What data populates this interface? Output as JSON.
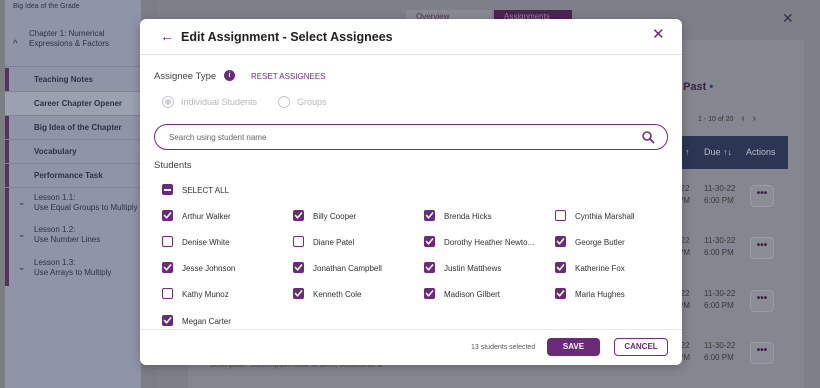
{
  "sidebar": {
    "top_item": "Big Idea of the Grade",
    "chapter": "Chapter 1: Numerical Expressions & Factors",
    "sub_items": [
      "Teaching Notes",
      "Career Chapter Opener",
      "Big Idea of the Chapter",
      "Vocabulary",
      "Performance Task"
    ],
    "lessons": [
      {
        "num": "Lesson 1.1:",
        "title": "Use Equal Groups to Multiply"
      },
      {
        "num": "Lesson 1.2:",
        "title": "Use Number Lines"
      },
      {
        "num": "Lesson 1.3:",
        "title": "Use Arrays to Multiply"
      }
    ]
  },
  "background": {
    "tabs": [
      "Overview",
      "Assignments"
    ],
    "past_label": "Past",
    "pagination": "1 - 10 of 20",
    "table_headers": [
      "↑",
      "Due ↑↓",
      "Actions"
    ],
    "rows": [
      {
        "c1a": "-22",
        "c1b": "PM",
        "due_date": "11-30-22",
        "due_time": "6:00 PM"
      },
      {
        "c1a": "-22",
        "c1b": "PM",
        "due_date": "11-30-22",
        "due_time": "6:00 PM"
      },
      {
        "c1a": "-22",
        "c1b": "PM",
        "due_date": "11-30-22",
        "due_time": "6:00 PM"
      },
      {
        "c1a": "-22",
        "c1b": "PM",
        "due_date": "11-30-22",
        "due_time": "6:00 PM"
      }
    ],
    "more_label": "•••",
    "footer_text": "Description - Lorem ipsum dolor sit amet, consectetur a"
  },
  "modal": {
    "title": "Edit Assignment - Select Assignees",
    "assignee_type_label": "Assignee Type",
    "reset_label": "RESET ASSIGNEES",
    "radio_individual": "Individual Students",
    "radio_groups": "Groups",
    "search_placeholder": "Search using student name",
    "students_label": "Students",
    "select_all_label": "SELECT ALL",
    "students": [
      {
        "name": "Arthur Walker",
        "checked": true
      },
      {
        "name": "Billy Cooper",
        "checked": true
      },
      {
        "name": "Brenda Hicks",
        "checked": true
      },
      {
        "name": "Cynthia Marshall",
        "checked": false
      },
      {
        "name": "Denise White",
        "checked": false
      },
      {
        "name": "Diane Patel",
        "checked": false
      },
      {
        "name": "Dorothy Heather Newto...",
        "checked": true
      },
      {
        "name": "George Butler",
        "checked": true
      },
      {
        "name": "Jesse Johnson",
        "checked": true
      },
      {
        "name": "Jonathan Campbell",
        "checked": true
      },
      {
        "name": "Justin Matthews",
        "checked": true
      },
      {
        "name": "Katherine Fox",
        "checked": true
      },
      {
        "name": "Kathy Munoz",
        "checked": false
      },
      {
        "name": "Kenneth Cole",
        "checked": true
      },
      {
        "name": "Madison Gilbert",
        "checked": true
      },
      {
        "name": "Maria Hughes",
        "checked": true
      },
      {
        "name": "Megan Carter",
        "checked": true
      }
    ],
    "selected_count_text": "13 students selected",
    "save_label": "SAVE",
    "cancel_label": "CANCEL"
  },
  "colors": {
    "accent": "#6b2a7a",
    "header_dark": "#2c3654"
  },
  "icons": {
    "back": "arrow-left-icon",
    "close": "close-icon",
    "info": "info-icon",
    "search": "search-icon"
  }
}
